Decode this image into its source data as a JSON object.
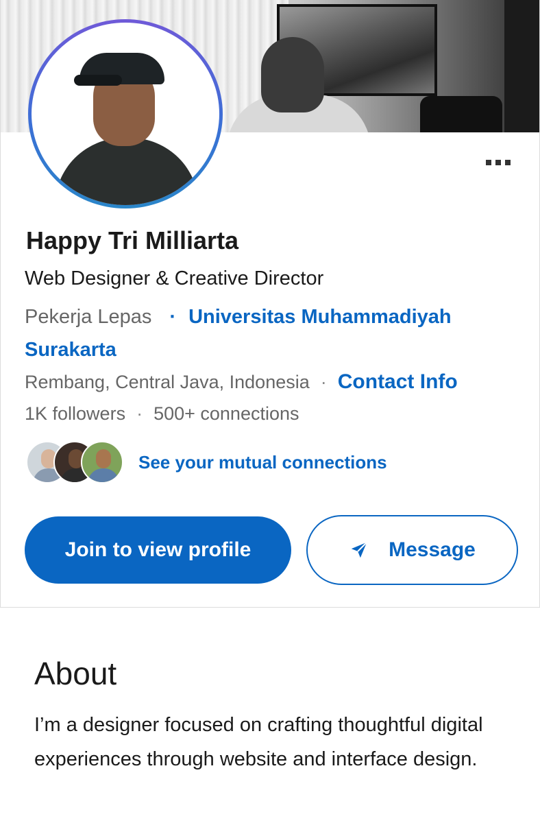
{
  "profile": {
    "name": "Happy Tri Milliarta",
    "headline": "Web Designer & Creative Director",
    "company": "Pekerja Lepas",
    "company_separator": "·",
    "school": "Universitas Muhammadiyah Surakarta",
    "location": "Rembang, Central Java, Indonesia",
    "location_separator": "·",
    "contact_info": "Contact Info",
    "followers": "1K followers",
    "stats_separator": "·",
    "connections": "500+ connections"
  },
  "mutual": {
    "link_label": "See your mutual connections",
    "avatars": [
      {
        "skin": "#d8b49a",
        "clothes": "#8a9bb0",
        "bg": "#cfd6db"
      },
      {
        "skin": "#6b4a34",
        "clothes": "#2b2b2b",
        "bg": "#3c2e28"
      },
      {
        "skin": "#a8764f",
        "clothes": "#5c7ea8",
        "bg": "#7fa35a"
      }
    ]
  },
  "actions": {
    "join_label": "Join to view profile",
    "message_label": "Message"
  },
  "icons": {
    "more": "more-horizontal-icon",
    "send": "send-icon"
  },
  "about": {
    "title": "About",
    "text": "I’m a designer focused on crafting thoughtful digital experiences through website and interface design."
  },
  "colors": {
    "accent": "#0a66c2",
    "text": "#1a1a1a",
    "muted": "#666666"
  }
}
